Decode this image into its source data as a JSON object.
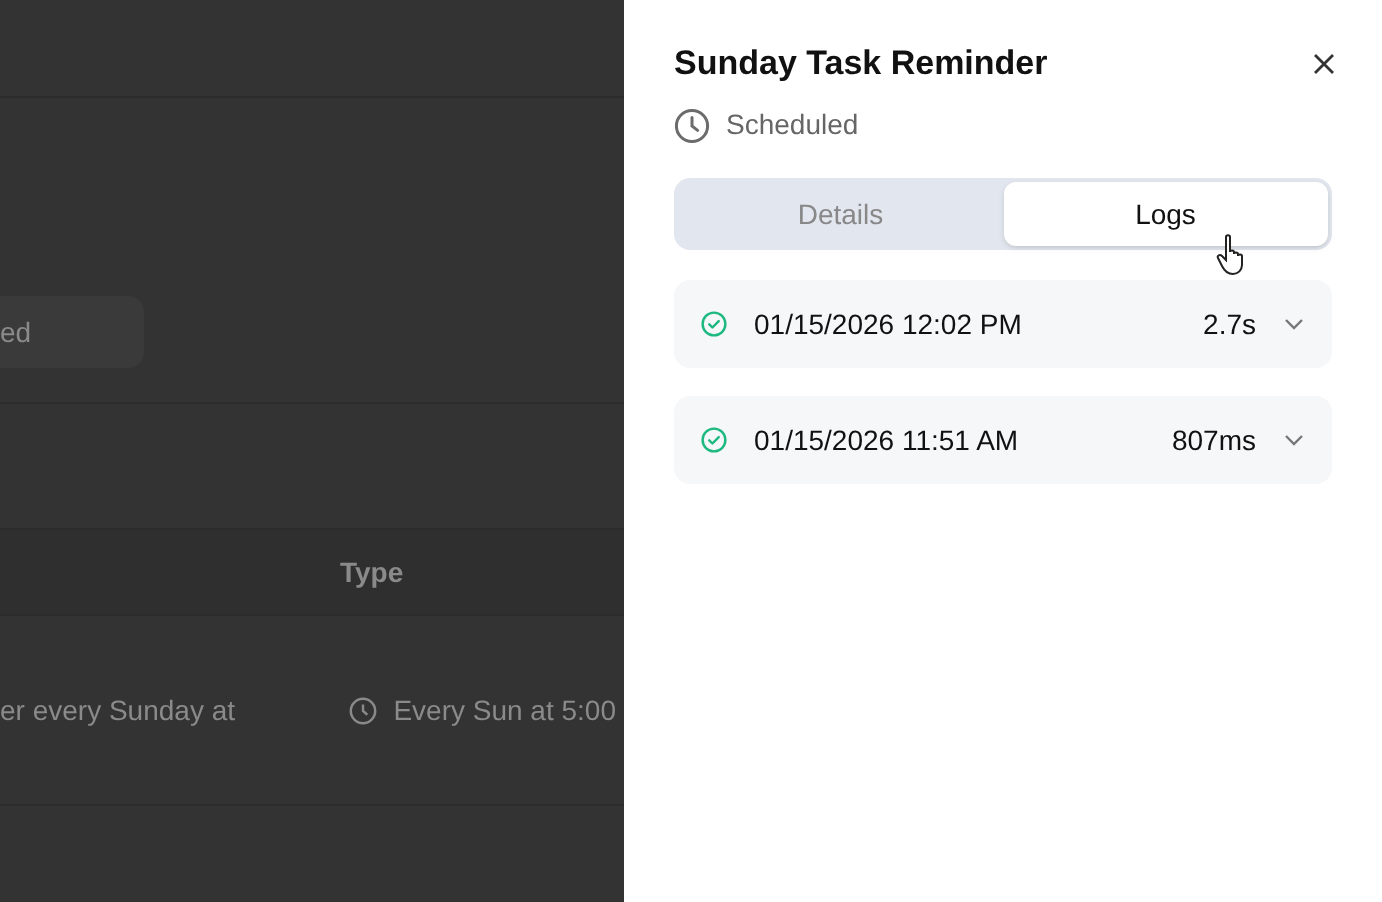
{
  "background_page": {
    "button_label": "ed",
    "table": {
      "column_2_header": "Type",
      "row": {
        "column_1": "er every Sunday at",
        "type": "Every Sun at 5:00"
      }
    }
  },
  "panel": {
    "title": "Sunday Task Reminder",
    "status": "Scheduled",
    "tabs": [
      {
        "label": "Details",
        "selected": false
      },
      {
        "label": "Logs",
        "selected": true
      }
    ],
    "logs": [
      {
        "succeeded": true,
        "time": "01/15/2026 12:02 PM",
        "duration": "2.7s",
        "expanded": false
      },
      {
        "succeeded": true,
        "time": "01/15/2026 11:51 AM",
        "duration": "807ms",
        "expanded": false
      }
    ]
  }
}
